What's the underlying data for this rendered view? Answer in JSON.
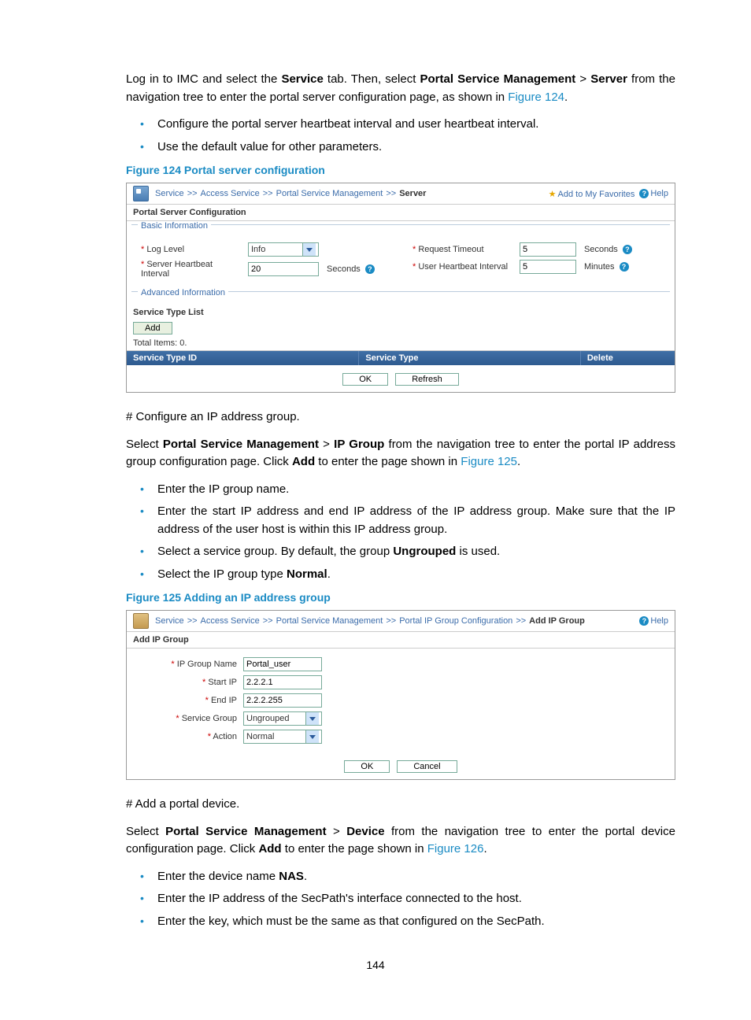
{
  "para1_parts": {
    "a": "Log in to IMC and select the ",
    "b": "Service",
    "c": " tab. Then, select ",
    "d": "Portal Service Management",
    "e": " > ",
    "f": "Server",
    "g": " from the navigation tree to enter the portal server configuration page, as shown in ",
    "link": "Figure 124",
    "end": "."
  },
  "bullets1": {
    "a": "Configure the portal server heartbeat interval and user heartbeat interval.",
    "b": "Use the default value for other parameters."
  },
  "fig124_caption": "Figure 124 Portal server configuration",
  "fig124": {
    "crumbs": {
      "service": "Service",
      "access": "Access Service",
      "portal": "Portal Service Management",
      "server": "Server",
      "sep": ">>"
    },
    "fav": "Add to My Favorites",
    "help": "Help",
    "section": "Portal Server Configuration",
    "basic_label": "Basic Information",
    "advanced_label": "Advanced Information",
    "log_level_label": "Log Level",
    "log_level_value": "Info",
    "server_hb_label": "Server Heartbeat Interval",
    "server_hb_value": "20",
    "seconds": "Seconds",
    "req_timeout_label": "Request Timeout",
    "req_timeout_value": "5",
    "user_hb_label": "User Heartbeat Interval",
    "user_hb_value": "5",
    "minutes": "Minutes",
    "svc_list": "Service Type List",
    "add": "Add",
    "total": "Total Items: 0.",
    "col_id": "Service Type ID",
    "col_type": "Service Type",
    "col_delete": "Delete",
    "ok": "OK",
    "refresh": "Refresh"
  },
  "hash1": "# Configure an IP address group.",
  "para2_parts": {
    "a": "Select ",
    "b": "Portal Service Management",
    "c": " > ",
    "d": "IP Group",
    "e": " from the navigation tree to enter the portal IP address group configuration page. Click ",
    "f": "Add",
    "g": " to enter the page shown in ",
    "link": "Figure 125",
    "end": "."
  },
  "bullets2": {
    "a": "Enter the IP group name.",
    "b": "Enter the start IP address and end IP address of the IP address group. Make sure that the IP address of the user host is within this IP address group.",
    "c_pre": "Select a service group. By default, the group ",
    "c_b": "Ungrouped",
    "c_post": " is used.",
    "d_pre": "Select the IP group type ",
    "d_b": "Normal",
    "d_post": "."
  },
  "fig125_caption": "Figure 125 Adding an IP address group",
  "fig125": {
    "crumbs": {
      "service": "Service",
      "access": "Access Service",
      "portal": "Portal Service Management",
      "ipg": "Portal IP Group Configuration",
      "add": "Add IP Group",
      "sep": ">>"
    },
    "help": "Help",
    "section": "Add IP Group",
    "name_label": "IP Group Name",
    "name_value": "Portal_user",
    "start_label": "Start IP",
    "start_value": "2.2.2.1",
    "end_label": "End IP",
    "end_value": "2.2.2.255",
    "svcgrp_label": "Service Group",
    "svcgrp_value": "Ungrouped",
    "action_label": "Action",
    "action_value": "Normal",
    "ok": "OK",
    "cancel": "Cancel"
  },
  "hash2": "# Add a portal device.",
  "para3_parts": {
    "a": "Select ",
    "b": "Portal Service Management",
    "c": " > ",
    "d": "Device",
    "e": " from the navigation tree to enter the portal device configuration page. Click ",
    "f": "Add",
    "g": " to enter the page shown in ",
    "link": "Figure 126",
    "end": "."
  },
  "bullets3": {
    "a_pre": "Enter the device name ",
    "a_b": "NAS",
    "a_post": ".",
    "b": "Enter the IP address of the SecPath's interface connected to the host.",
    "c": "Enter the key, which must be the same as that configured on the SecPath."
  },
  "page_number": "144"
}
